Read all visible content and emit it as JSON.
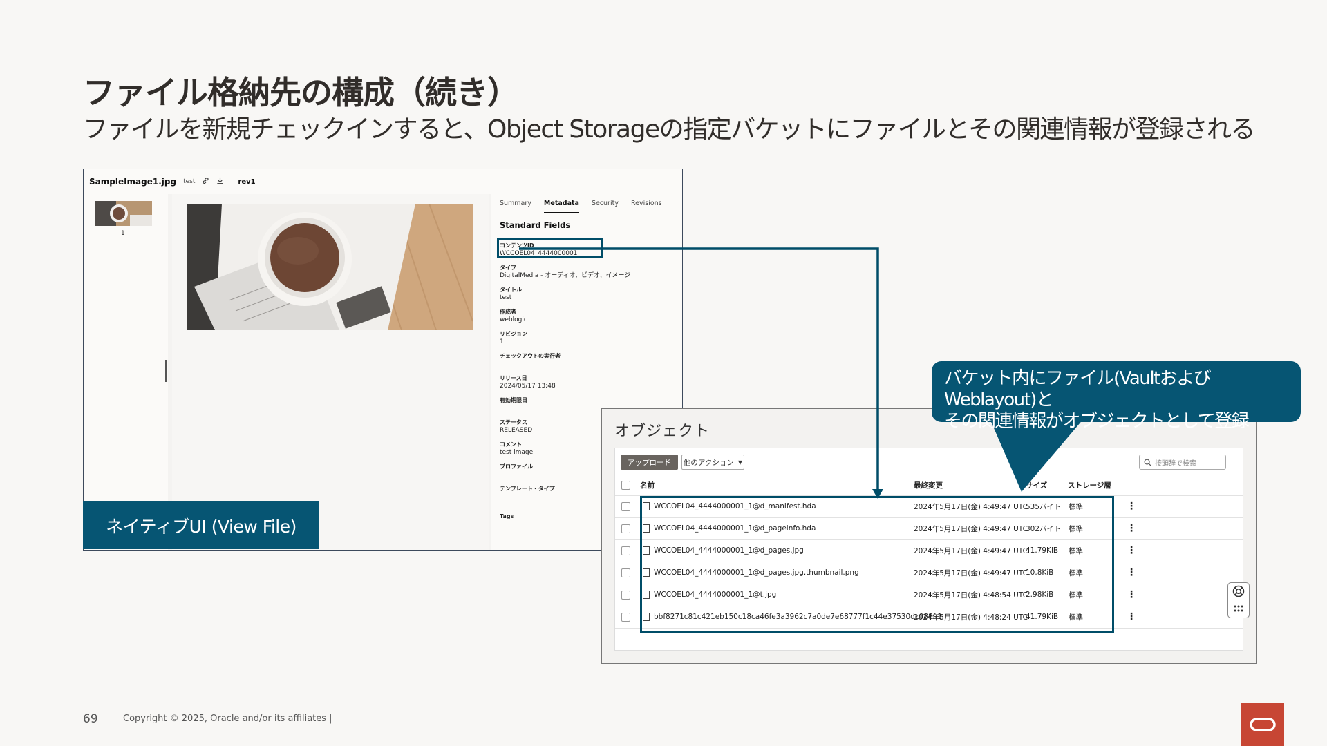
{
  "slide": {
    "title": "ファイル格納先の構成（続き）",
    "subtitle": "ファイルを新規チェックインすると、Object Storageの指定バケットにファイルとその関連情報が登録される",
    "page_number": "69",
    "copyright": "Copyright © 2025, Oracle and/or its affiliates |"
  },
  "native_ui": {
    "file_name": "SampleImage1.jpg",
    "file_tag": "test",
    "revision": "rev1",
    "thumbnail_number": "1",
    "tabs": [
      "Summary",
      "Metadata",
      "Security",
      "Revisions"
    ],
    "active_tab": "Metadata",
    "section_title": "Standard Fields",
    "fields": [
      {
        "key": "コンテンツID",
        "value": "WCCOEL04_4444000001"
      },
      {
        "key": "タイプ",
        "value": "DigitalMedia - オーディオ、ビデオ、イメージ"
      },
      {
        "key": "タイトル",
        "value": "test"
      },
      {
        "key": "作成者",
        "value": "weblogic"
      },
      {
        "key": "リビジョン",
        "value": "1"
      },
      {
        "key": "チェックアウトの実行者",
        "value": ""
      },
      {
        "key": "リリース日",
        "value": "2024/05/17 13:48"
      },
      {
        "key": "有効期限日",
        "value": ""
      },
      {
        "key": "ステータス",
        "value": "RELEASED"
      },
      {
        "key": "コメント",
        "value": "test image"
      },
      {
        "key": "プロファイル",
        "value": ""
      },
      {
        "key": "テンプレート・タイプ",
        "value": ""
      },
      {
        "key": "Tags",
        "value": ""
      }
    ],
    "label": "ネイティブUI (View File)"
  },
  "object_storage": {
    "title": "オブジェクト",
    "upload_button": "アップロード",
    "more_actions_button": "他のアクション",
    "search_placeholder": "接頭辞で検索",
    "columns": [
      "名前",
      "最終変更",
      "サイズ",
      "ストレージ層"
    ],
    "rows": [
      {
        "name": "WCCOEL04_4444000001_1@d_manifest.hda",
        "modified": "2024年5月17日(金) 4:49:47 UTC",
        "size": "535バイト",
        "tier": "標準"
      },
      {
        "name": "WCCOEL04_4444000001_1@d_pageinfo.hda",
        "modified": "2024年5月17日(金) 4:49:47 UTC",
        "size": "302バイト",
        "tier": "標準"
      },
      {
        "name": "WCCOEL04_4444000001_1@d_pages.jpg",
        "modified": "2024年5月17日(金) 4:49:47 UTC",
        "size": "41.79KiB",
        "tier": "標準"
      },
      {
        "name": "WCCOEL04_4444000001_1@d_pages.jpg.thumbnail.png",
        "modified": "2024年5月17日(金) 4:49:47 UTC",
        "size": "10.8KiB",
        "tier": "標準"
      },
      {
        "name": "WCCOEL04_4444000001_1@t.jpg",
        "modified": "2024年5月17日(金) 4:48:54 UTC",
        "size": "2.98KiB",
        "tier": "標準"
      },
      {
        "name": "bbf8271c81c421eb150c18ca46fe3a3962c7a0de7e68777f1c44e37530dc088f-1",
        "modified": "2024年5月17日(金) 4:48:24 UTC",
        "size": "41.79KiB",
        "tier": "標準"
      }
    ]
  },
  "callout": {
    "line1": "バケット内にファイル(VaultおよびWeblayout)と",
    "line2": "その関連情報がオブジェクトとして登録"
  },
  "colors": {
    "accent": "#065573",
    "highlight": "#004d68",
    "oracle_red": "#c74634"
  }
}
